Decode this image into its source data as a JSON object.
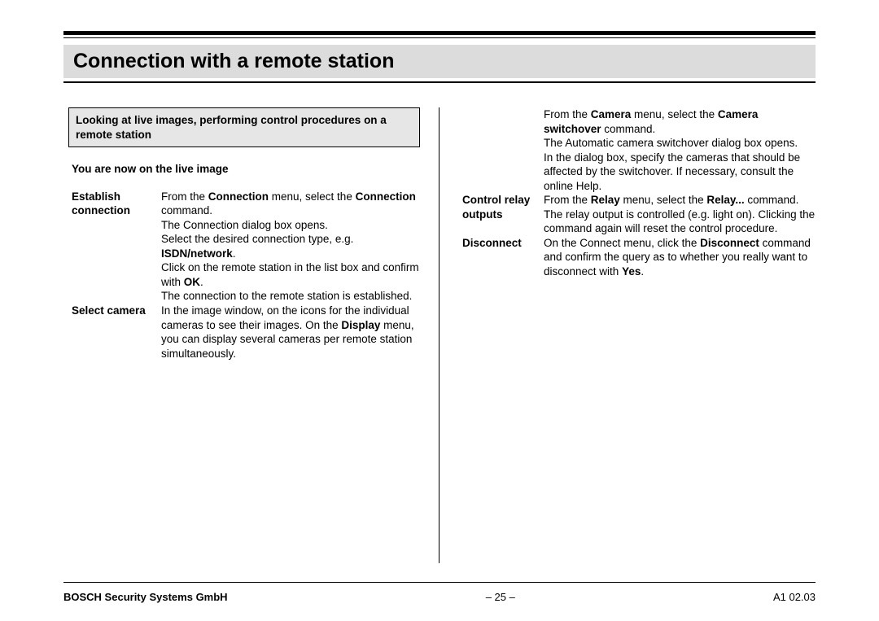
{
  "title": "Connection with a remote station",
  "callout": "Looking at live images, performing control procedures on a remote station",
  "subhead": "You are now on the live image",
  "left_entries": [
    {
      "term": "Establish connection",
      "desc_html": "From the <b>Connection</b> menu, select the <b>Connection</b> command.<br>The Connection dialog box opens.<br>Select the desired connection type, e.g. <b>ISDN/network</b>.<br>Click on the remote station in the list box and confirm with <b>OK</b>.<br>The connection to the remote station is established."
    },
    {
      "term": "Select camera",
      "desc_html": "In the image window, on the icons for the individual cameras to see their images. On the <b>Display</b> menu, you can display several cameras per remote station simultaneously."
    }
  ],
  "right_lead_html": "From the <b>Camera</b> menu, select the <b>Camera switchover</b> command.<br>The Automatic camera switchover dialog box opens.<br>In the dialog box, specify the cameras that should be affected by the switchover. If necessary, consult the online Help.",
  "right_entries": [
    {
      "term": "Control relay outputs",
      "desc_html": "From the <b>Relay</b> menu, select the <b>Relay...</b> command. The relay output is controlled (e.g. light on). Clicking the command again will reset the control procedure."
    },
    {
      "term": "Disconnect",
      "desc_html": "On the Connect menu, click the <b>Disconnect</b> command and confirm the query as to whether you really want to disconnect with <b>Yes</b>."
    }
  ],
  "footer": {
    "left": "BOSCH Security Systems GmbH",
    "center": "–  25  –",
    "right": "A1 02.03"
  }
}
